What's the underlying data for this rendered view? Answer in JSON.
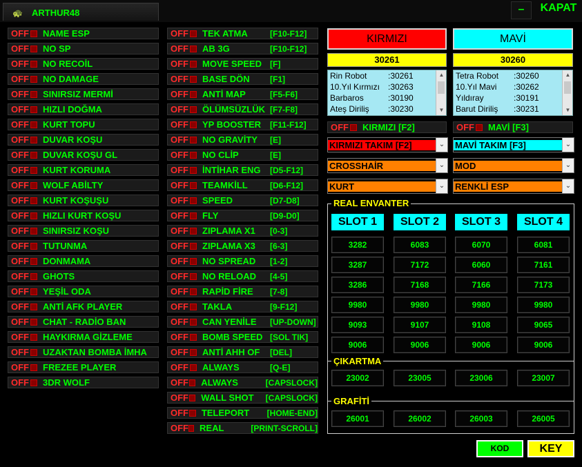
{
  "app": {
    "title": "ARTHUR48",
    "minimize_label": "–",
    "close_label": "KAPAT",
    "logo_icon": "turtle-icon"
  },
  "off_label": "OFF",
  "left_features": [
    "NAME ESP",
    "NO SP",
    "NO RECOİL",
    "NO DAMAGE",
    "SINIRSIZ MERMİ",
    "HIZLI DOĞMA",
    "KURT TOPU",
    "DUVAR KOŞU",
    "DUVAR KOŞU GL",
    "KURT KORUMA",
    "WOLF ABİLTY",
    "KURT KOŞUŞU",
    "HIZLI KURT KOŞU",
    "SINIRSIZ KOŞU",
    "TUTUNMA",
    "DONMAMA",
    "GHOTS",
    "YEŞİL ODA",
    "ANTİ AFK PLAYER",
    "CHAT - RADİO BAN",
    "HAYKIRMA GİZLEME",
    "UZAKTAN BOMBA İMHA",
    "FREZEE PLAYER",
    "3DR WOLF"
  ],
  "mid_features": [
    {
      "name": "TEK ATMA",
      "key": "[F10-F12]"
    },
    {
      "name": "AB 3G",
      "key": "[F10-F12]"
    },
    {
      "name": "MOVE SPEED",
      "key": "[F]"
    },
    {
      "name": "BASE DÖN",
      "key": "[F1]"
    },
    {
      "name": "ANTİ MAP",
      "key": "[F5-F6]"
    },
    {
      "name": "ÖLÜMSÜZLÜK",
      "key": "[F7-F8]"
    },
    {
      "name": "YP BOOSTER",
      "key": "[F11-F12]"
    },
    {
      "name": "NO GRAVİTY",
      "key": "[E]"
    },
    {
      "name": "NO CLİP",
      "key": "[E]"
    },
    {
      "name": "İNTİHAR ENG",
      "key": "[D5-F12]"
    },
    {
      "name": "TEAMKİLL",
      "key": "[D6-F12]"
    },
    {
      "name": "SPEED",
      "key": "[D7-D8]"
    },
    {
      "name": "FLY",
      "key": "[D9-D0]"
    },
    {
      "name": "ZIPLAMA X1",
      "key": "[0-3]"
    },
    {
      "name": "ZIPLAMA X3",
      "key": "[6-3]"
    },
    {
      "name": "NO SPREAD",
      "key": "[1-2]"
    },
    {
      "name": "NO RELOAD",
      "key": "[4-5]"
    },
    {
      "name": "RAPİD FİRE",
      "key": "[7-8]"
    },
    {
      "name": "TAKLA",
      "key": "[9-F12]"
    },
    {
      "name": "CAN YENİLE",
      "key": "[UP-DOWN]"
    },
    {
      "name": "BOMB SPEED",
      "key": "[SOL TIK]"
    },
    {
      "name": "ANTİ AHH OF",
      "key": "[DEL]"
    },
    {
      "name": "ALWAYS",
      "key": "[Q-E]"
    },
    {
      "name": "ALWAYS",
      "key": "[CAPSLOCK]"
    },
    {
      "name": "WALL SHOT",
      "key": "[CAPSLOCK]"
    },
    {
      "name": "TELEPORT",
      "key": "[HOME-END]"
    },
    {
      "name": "REAL",
      "key": "[PRINT-SCROLL]"
    }
  ],
  "teams": {
    "red": {
      "label": "KIRMIZI",
      "score": "30261",
      "items": [
        {
          "name": "Rin Robot",
          "code": ":30261"
        },
        {
          "name": "10.Yıl Kırmızı",
          "code": ":30263"
        },
        {
          "name": "Barbaros",
          "code": ":30190"
        },
        {
          "name": "Ateş Diriliş",
          "code": ":30230"
        }
      ],
      "toggle_label": "KIRMIZI [F2]"
    },
    "blue": {
      "label": "MAVİ",
      "score": "30260",
      "items": [
        {
          "name": "Tetra Robot",
          "code": ":30260"
        },
        {
          "name": "10.Yıl Mavi",
          "code": ":30262"
        },
        {
          "name": "Yıldıray",
          "code": ":30191"
        },
        {
          "name": "Barut Diriliş",
          "code": ":30231"
        }
      ],
      "toggle_label": "MAVİ [F3]"
    }
  },
  "dropdowns": {
    "team_red": {
      "value": "KIRMIZI TAKIM  [F2]",
      "bg": "#ff0000",
      "color": "#000000"
    },
    "team_blue": {
      "value": "MAVİ TAKIM  [F3]",
      "bg": "#00ffff",
      "color": "#000000"
    },
    "crosshair": {
      "value": "CROSSHAİR",
      "bg": "#ff8000",
      "color": "#000000"
    },
    "mod": {
      "value": "MOD",
      "bg": "#ff8000",
      "color": "#000000"
    },
    "kurt": {
      "value": "KURT",
      "bg": "#ff8000",
      "color": "#000000"
    },
    "renkli_esp": {
      "value": "RENKLİ ESP",
      "bg": "#ff8000",
      "color": "#000000"
    }
  },
  "inventory": {
    "title": "REAL ENVANTER",
    "slots": [
      "SLOT 1",
      "SLOT 2",
      "SLOT 3",
      "SLOT 4"
    ],
    "rows": [
      [
        "3282",
        "6083",
        "6070",
        "6081"
      ],
      [
        "3287",
        "7172",
        "6060",
        "7161"
      ],
      [
        "3286",
        "7168",
        "7166",
        "7173"
      ],
      [
        "9980",
        "9980",
        "9980",
        "9980"
      ],
      [
        "9093",
        "9107",
        "9108",
        "9065"
      ],
      [
        "9006",
        "9006",
        "9006",
        "9006"
      ]
    ],
    "cikartma_title": "ÇIKARTMA",
    "cikartma": [
      "23002",
      "23005",
      "23006",
      "23007"
    ],
    "grafiti_title": "GRAFİTİ",
    "grafiti": [
      "26001",
      "26002",
      "26003",
      "26005"
    ]
  },
  "buttons": {
    "kod": "KOD",
    "key": "KEY"
  },
  "colors": {
    "accent_green": "#00ff00",
    "off_red": "#ff2a2a",
    "red_team": "#ff0000",
    "blue_team": "#00ffff",
    "highlight_yellow": "#ffff00",
    "orange": "#ff8000"
  }
}
